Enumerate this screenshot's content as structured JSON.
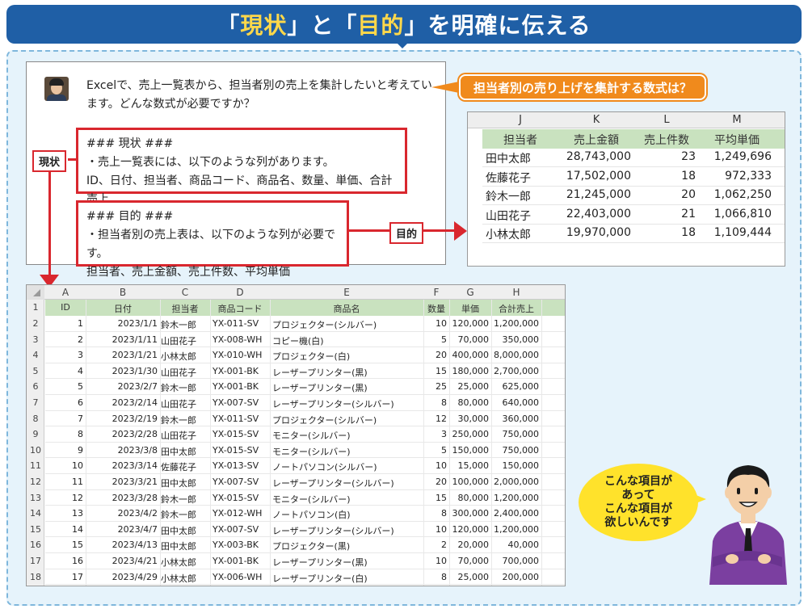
{
  "header": {
    "part1": "「",
    "hl1": "現状",
    "part2": "」と「",
    "hl2": "目的",
    "part3": "」を明確に伝える"
  },
  "chat": {
    "question": "Excelで、売上一覧表から、担当者別の売上を集計したいと考えています。どんな数式が必要ですか？",
    "genjo": {
      "heading": "### 現状 ###",
      "line1": "・売上一覧表には、以下のような列があります。",
      "line2": "ID、日付、担当者、商品コード、商品名、数量、単価、合計売上"
    },
    "mokuteki": {
      "heading": "### 目的 ###",
      "line1": "・担当者別の売上表は、以下のような列が必要です。",
      "line2": "担当者、売上金額、売上件数、平均単価"
    }
  },
  "tags": {
    "genjo": "現状",
    "mokuteki": "目的"
  },
  "callout": "担当者別の売り上げを集計する数式は？",
  "result_table": {
    "col_letters": [
      "J",
      "K",
      "L",
      "M"
    ],
    "headers": [
      "担当者",
      "売上金額",
      "売上件数",
      "平均単価"
    ],
    "rows": [
      [
        "田中太郎",
        "28,743,000",
        "23",
        "1,249,696"
      ],
      [
        "佐藤花子",
        "17,502,000",
        "18",
        "972,333"
      ],
      [
        "鈴木一郎",
        "21,245,000",
        "20",
        "1,062,250"
      ],
      [
        "山田花子",
        "22,403,000",
        "21",
        "1,066,810"
      ],
      [
        "小林太郎",
        "19,970,000",
        "18",
        "1,109,444"
      ]
    ]
  },
  "sheet": {
    "col_letters": [
      "A",
      "B",
      "C",
      "D",
      "E",
      "F",
      "G",
      "H"
    ],
    "row_numbers": [
      "1",
      "2",
      "3",
      "4",
      "5",
      "6",
      "7",
      "8",
      "9",
      "10",
      "11",
      "12",
      "13",
      "14",
      "15",
      "16",
      "17",
      "18"
    ],
    "headers": [
      "ID",
      "日付",
      "担当者",
      "商品コード",
      "商品名",
      "数量",
      "単価",
      "合計売上"
    ],
    "rows": [
      [
        "1",
        "2023/1/1",
        "鈴木一郎",
        "YX-011-SV",
        "プロジェクター(シルバー)",
        "10",
        "120,000",
        "1,200,000"
      ],
      [
        "2",
        "2023/1/11",
        "山田花子",
        "YX-008-WH",
        "コピー機(白)",
        "5",
        "70,000",
        "350,000"
      ],
      [
        "3",
        "2023/1/21",
        "小林太郎",
        "YX-010-WH",
        "プロジェクター(白)",
        "20",
        "400,000",
        "8,000,000"
      ],
      [
        "4",
        "2023/1/30",
        "山田花子",
        "YX-001-BK",
        "レーザープリンター(黒)",
        "15",
        "180,000",
        "2,700,000"
      ],
      [
        "5",
        "2023/2/7",
        "鈴木一郎",
        "YX-001-BK",
        "レーザープリンター(黒)",
        "25",
        "25,000",
        "625,000"
      ],
      [
        "6",
        "2023/2/14",
        "山田花子",
        "YX-007-SV",
        "レーザープリンター(シルバー)",
        "8",
        "80,000",
        "640,000"
      ],
      [
        "7",
        "2023/2/19",
        "鈴木一郎",
        "YX-011-SV",
        "プロジェクター(シルバー)",
        "12",
        "30,000",
        "360,000"
      ],
      [
        "8",
        "2023/2/28",
        "山田花子",
        "YX-015-SV",
        "モニター(シルバー)",
        "3",
        "250,000",
        "750,000"
      ],
      [
        "9",
        "2023/3/8",
        "田中太郎",
        "YX-015-SV",
        "モニター(シルバー)",
        "5",
        "150,000",
        "750,000"
      ],
      [
        "10",
        "2023/3/14",
        "佐藤花子",
        "YX-013-SV",
        "ノートパソコン(シルバー)",
        "10",
        "15,000",
        "150,000"
      ],
      [
        "11",
        "2023/3/21",
        "田中太郎",
        "YX-007-SV",
        "レーザープリンター(シルバー)",
        "20",
        "100,000",
        "2,000,000"
      ],
      [
        "12",
        "2023/3/28",
        "鈴木一郎",
        "YX-015-SV",
        "モニター(シルバー)",
        "15",
        "80,000",
        "1,200,000"
      ],
      [
        "13",
        "2023/4/2",
        "鈴木一郎",
        "YX-012-WH",
        "ノートパソコン(白)",
        "8",
        "300,000",
        "2,400,000"
      ],
      [
        "14",
        "2023/4/7",
        "田中太郎",
        "YX-007-SV",
        "レーザープリンター(シルバー)",
        "10",
        "120,000",
        "1,200,000"
      ],
      [
        "15",
        "2023/4/13",
        "田中太郎",
        "YX-003-BK",
        "プロジェクター(黒)",
        "2",
        "20,000",
        "40,000"
      ],
      [
        "16",
        "2023/4/21",
        "小林太郎",
        "YX-001-BK",
        "レーザープリンター(黒)",
        "10",
        "70,000",
        "700,000"
      ],
      [
        "17",
        "2023/4/29",
        "小林太郎",
        "YX-006-WH",
        "レーザープリンター(白)",
        "8",
        "25,000",
        "200,000"
      ]
    ]
  },
  "bubble": {
    "line1": "こんな項目が",
    "line2": "あって",
    "line3": "こんな項目が",
    "line4": "欲しいんです"
  },
  "colors": {
    "header_bg": "#1f5fa6",
    "highlight": "#ffd84a",
    "red": "#d9272e",
    "orange": "#f08a1c",
    "green_header": "#c9e2bf",
    "bubble": "#ffe22b",
    "panel_bg": "#e6f3fb"
  }
}
